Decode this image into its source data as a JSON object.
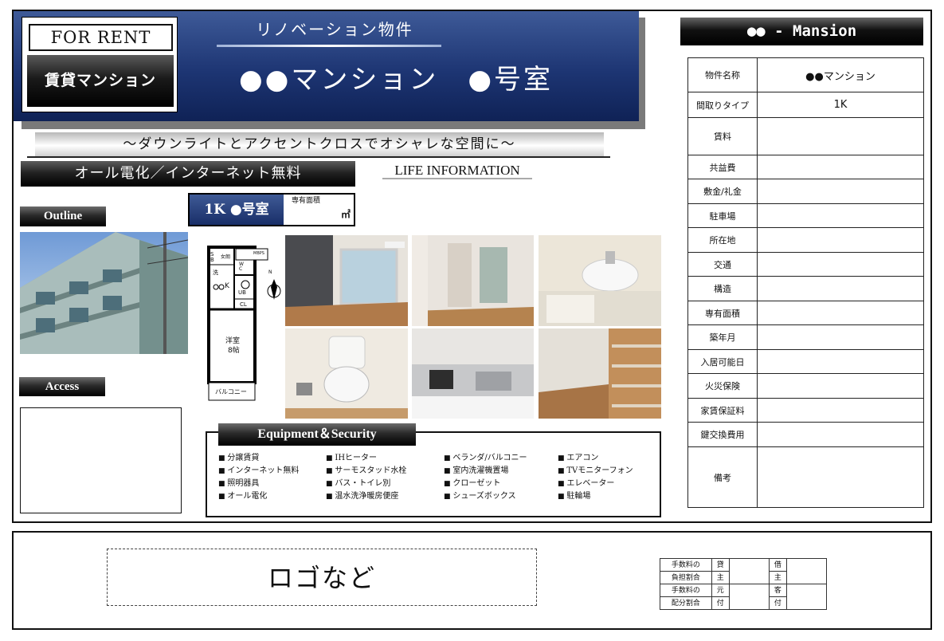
{
  "banner": {
    "for_rent": "FOR RENT",
    "chintai": "賃貸マンション",
    "renovation": "リノベーション物件",
    "building_name": "●●マンション　●号室"
  },
  "catchphrase": "～ダウンライトとアクセントクロスでオシャレな空間に～",
  "all_electric": "オール電化／インターネット無料",
  "life_information": "LIFE INFORMATION",
  "outline_label": "Outline",
  "access_label": "Access",
  "room": {
    "label": "1K ●号室",
    "area_label": "専有面積",
    "area_unit": "㎡"
  },
  "floorplan": {
    "labels": [
      "S",
      "B",
      "女朗",
      "洗",
      "K",
      "W",
      "C",
      "UB",
      "CL",
      "MBPS",
      "洋室",
      "8帖",
      "バルコニー",
      "N"
    ]
  },
  "equipment": {
    "title": "Equipment＆Security",
    "columns": [
      [
        "分譲賃貸",
        "インターネット無料",
        "照明器具",
        "オール電化"
      ],
      [
        "IHヒーター",
        "サーモスタッド水栓",
        "バス・トイレ別",
        "温水洗浄暖房便座"
      ],
      [
        "ベランダ/バルコニー",
        "室内洗濯機置場",
        "クローゼット",
        "シューズボックス"
      ],
      [
        "エアコン",
        "TVモニターフォン",
        "エレベーター",
        "駐輪場"
      ]
    ]
  },
  "property": {
    "header": "●● - Mansion",
    "rows": [
      {
        "key": "物件名称",
        "value": "●●マンション"
      },
      {
        "key": "間取りタイプ",
        "value": "1K"
      },
      {
        "key": "賃料",
        "value": ""
      },
      {
        "key": "共益費",
        "value": ""
      },
      {
        "key": "敷金/礼金",
        "value": ""
      },
      {
        "key": "駐車場",
        "value": ""
      },
      {
        "key": "所在地",
        "value": ""
      },
      {
        "key": "交通",
        "value": ""
      },
      {
        "key": "構造",
        "value": ""
      },
      {
        "key": "専有面積",
        "value": ""
      },
      {
        "key": "築年月",
        "value": ""
      },
      {
        "key": "入居可能日",
        "value": ""
      },
      {
        "key": "火災保険",
        "value": ""
      },
      {
        "key": "家賃保証料",
        "value": ""
      },
      {
        "key": "鍵交換費用",
        "value": ""
      },
      {
        "key": "備考",
        "value": ""
      }
    ]
  },
  "footer": {
    "logo_placeholder": "ロゴなど",
    "fee": {
      "r1_label": "手数料の",
      "r1_label2": "負担割合",
      "r1_a": "貸",
      "r1_a2": "主",
      "r1_b": "借",
      "r1_b2": "主",
      "r2_label": "手数料の",
      "r2_label2": "配分割合",
      "r2_a": "元",
      "r2_a2": "付",
      "r2_b": "客",
      "r2_b2": "付"
    }
  }
}
